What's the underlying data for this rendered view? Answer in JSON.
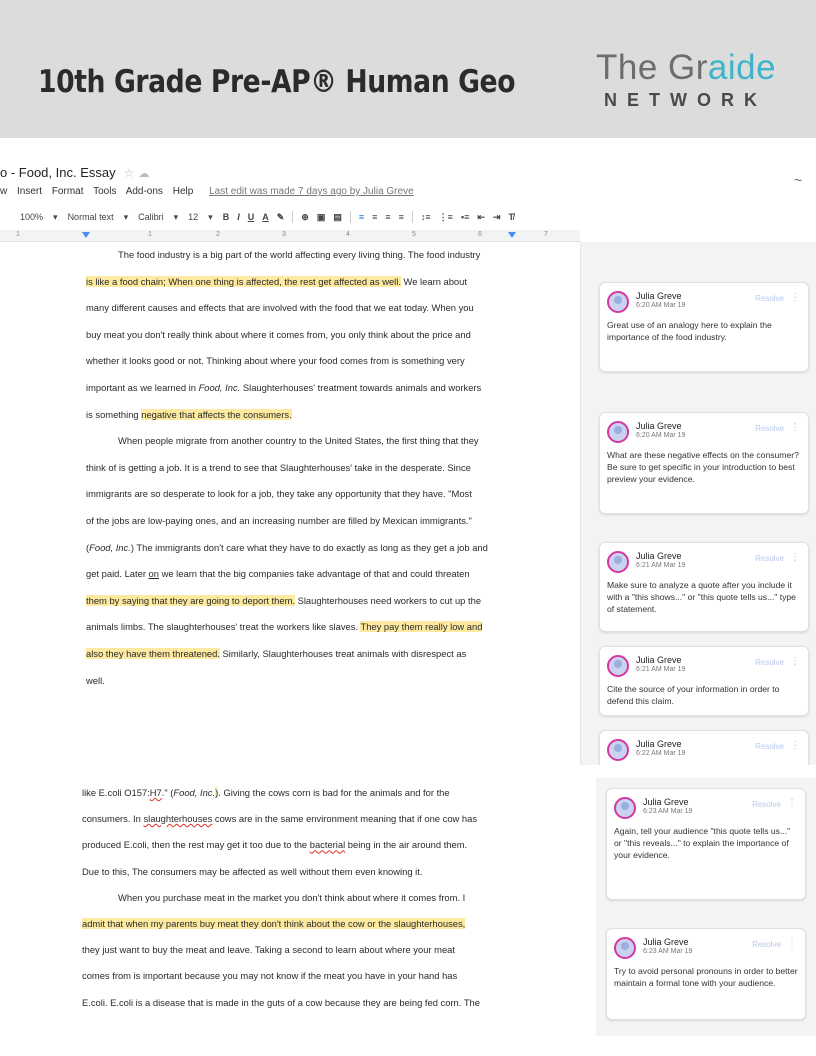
{
  "banner": {
    "title": "10th Grade Pre-AP® Human Geo",
    "brand_top_plain": "The Gr",
    "brand_top_accent": "aide",
    "brand_bottom": "NETWORK"
  },
  "doc": {
    "title": "o - Food, Inc. Essay",
    "star": "☆",
    "cloud": "☁",
    "menu": [
      "w",
      "Insert",
      "Format",
      "Tools",
      "Add-ons",
      "Help"
    ],
    "last_edit": "Last edit was made 7 days ago by Julia Greve",
    "trend_icon": "~"
  },
  "toolbar": {
    "zoom": "100%",
    "style": "Normal text",
    "font": "Calibri",
    "size": "12",
    "bold": "B",
    "italic": "I",
    "underline": "U",
    "text_color": "A",
    "highlight": "✎",
    "link": "⊕",
    "comment": "▣",
    "image": "▤",
    "align_left": "≡",
    "align_center": "≡",
    "align_right": "≡",
    "justify": "≡",
    "line_spacing": "↕≡",
    "numbered_list": "⋮≡",
    "bulleted_list": "•≡",
    "decrease_indent": "⇤",
    "increase_indent": "⇥",
    "clear_format": "T̸"
  },
  "ruler": [
    "1",
    "2",
    "3",
    "4",
    "5",
    "6",
    "7"
  ],
  "essay1": [
    [
      {
        "t": "The food industry is a big part of the world affecting every living thing. The food industry"
      }
    ],
    [
      {
        "t": "is like a food chain; When one thing is affected, the rest get affected as well.",
        "h": true
      },
      {
        "t": " We learn about"
      }
    ],
    [
      {
        "t": "many different causes and effects that are involved with the food that we eat today.  When you"
      }
    ],
    [
      {
        "t": "buy meat you don't really think about where it comes from, you only think about the price and"
      }
    ],
    [
      {
        "t": "whether it looks good or not. Thinking about where your food comes from is something very"
      }
    ],
    [
      {
        "t": "important as we learned in "
      },
      {
        "t": "Food, Inc.",
        "i": true
      },
      {
        "t": " Slaughterhouses' treatment towards animals and workers"
      }
    ],
    [
      {
        "t": "is something "
      },
      {
        "t": "negative that affects the consumers.",
        "h": true
      }
    ],
    [
      {
        "t": "When people migrate from another country to the United States, the first thing that they"
      }
    ],
    [
      {
        "t": "think of is getting a job. It is a trend to see that Slaughterhouses' take in the desperate. Since"
      }
    ],
    [
      {
        "t": "immigrants are so desperate to look for a job, they take any opportunity that they have. \"Most"
      }
    ],
    [
      {
        "t": "of the jobs are low-paying ones, and an increasing number are filled by Mexican immigrants.\""
      }
    ],
    [
      {
        "t": "("
      },
      {
        "t": "Food, Inc.",
        "i": true
      },
      {
        "t": ") The immigrants don't care what they have to do exactly as long as they get a job and"
      }
    ],
    [
      {
        "t": "get paid. Later "
      },
      {
        "t": "on",
        "u": true
      },
      {
        "t": " we learn that the big companies take advantage of that and could threaten"
      }
    ],
    [
      {
        "t": "them by saying that they are going to deport them.",
        "h": true
      },
      {
        "t": " Slaughterhouses need workers to cut up the"
      }
    ],
    [
      {
        "t": "animals limbs. The slaughterhouses' treat the workers like slaves. "
      },
      {
        "t": "They pay them really low and",
        "h": true
      }
    ],
    [
      {
        "t": "also they have them threatened.",
        "h": true
      },
      {
        "t": " Similarly, Slaughterhouses treat animals with disrespect as"
      }
    ],
    [
      {
        "t": "well."
      }
    ]
  ],
  "essay2": [
    [
      {
        "t": "like E.coli O157:"
      },
      {
        "t": "H7",
        "r": true
      },
      {
        "t": ".\" ("
      },
      {
        "t": "Food, Inc.",
        "i": true
      },
      {
        "t": ")",
        "h": true
      },
      {
        "t": ". Giving the cows corn is bad for the animals and for the"
      }
    ],
    [
      {
        "t": "consumers. In "
      },
      {
        "t": "slaughterhouses",
        "r": true
      },
      {
        "t": " cows are in the same environment meaning that if one cow has"
      }
    ],
    [
      {
        "t": "produced E.coli, then the rest may get it too due to the "
      },
      {
        "t": "bacterial",
        "r": true
      },
      {
        "t": " being in the air around them."
      }
    ],
    [
      {
        "t": "Due to this, The consumers may be affected as well without them even knowing it."
      }
    ],
    [
      {
        "t": "When you purchase meat in the market you don't think about where it comes from. I"
      }
    ],
    [
      {
        "t": "admit that when my parents buy meat they don't think about the cow or the slaughterhouses,",
        "h": true
      }
    ],
    [
      {
        "t": "they just want to buy the meat and leave. Taking a second to learn about where your meat"
      }
    ],
    [
      {
        "t": "comes from is important because you may not know if the meat you have in your hand has"
      }
    ],
    [
      {
        "t": "E.coli. E.coli is a disease that is made in the guts of a cow because they are being fed corn. The"
      }
    ]
  ],
  "comments1": [
    {
      "author": "Julia Greve",
      "time": "6:20 AM Mar 19",
      "resolve": "Resolve",
      "more": "⋮",
      "body": "Great use of an analogy here to explain the importance of the food industry."
    },
    {
      "author": "Julia Greve",
      "time": "6:20 AM Mar 19",
      "resolve": "Resolve",
      "more": "⋮",
      "body": "What are these negative effects on the consumer? Be sure to get specific in your introduction to best preview your evidence."
    },
    {
      "author": "Julia Greve",
      "time": "6:21 AM Mar 19",
      "resolve": "Resolve",
      "more": "⋮",
      "body": "Make sure to analyze a quote after you include it with a \"this shows...\" or \"this quote tells us...\" type of statement."
    },
    {
      "author": "Julia Greve",
      "time": "6:21 AM Mar 19",
      "resolve": "Resolve",
      "more": "⋮",
      "body": "Cite the source of your information in order to defend this claim."
    },
    {
      "author": "Julia Greve",
      "time": "6:22 AM Mar 19",
      "resolve": "Resolve",
      "more": "⋮",
      "body": ""
    }
  ],
  "comments2": [
    {
      "author": "Julia Greve",
      "time": "6:23 AM Mar 19",
      "resolve": "Resolve",
      "more": "⋮",
      "body": "Again, tell your audience \"this quote tells us...\" or \"this reveals...\" to explain the importance of your evidence."
    },
    {
      "author": "Julia Greve",
      "time": "6:23 AM Mar 19",
      "resolve": "Resolve",
      "more": "⋮",
      "body": "Try to avoid personal pronouns in order to better maintain a formal tone with your audience."
    }
  ]
}
